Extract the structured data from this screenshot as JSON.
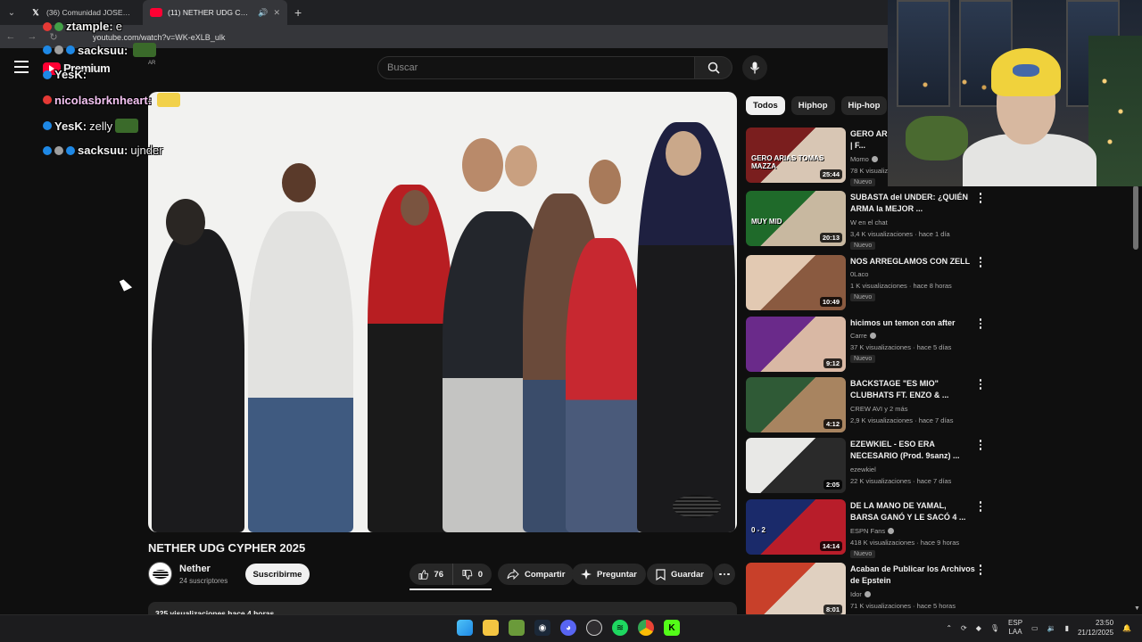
{
  "browser": {
    "tabs": [
      {
        "label": "(36) Comunidad JOSEO EXCLUSIVO",
        "active": false,
        "icon": "x-logo-icon"
      },
      {
        "label": "(11) NETHER UDG CYPHER 2025",
        "active": true,
        "icon": "youtube-icon"
      }
    ],
    "new_tab": "+",
    "url": "youtube.com/watch?v=WK-eXLB_ulk"
  },
  "youtube": {
    "logo_text": "Premium",
    "country_code": "AR",
    "search_placeholder": "Buscar",
    "video": {
      "title": "NETHER UDG CYPHER 2025",
      "channel": "Nether",
      "subscribers": "24 suscriptores",
      "subscribe_label": "Suscribirme",
      "likes": "76",
      "dislikes": "0",
      "share_label": "Compartir",
      "ask_label": "Preguntar",
      "save_label": "Guardar",
      "description_stats": "325 visualizaciones  hace 4 horas"
    },
    "chips": [
      "Todos",
      "Hiphop",
      "Hip-hop"
    ],
    "recommendations": [
      {
        "title": "GERO ARIAS VS TOMAS MAZZA | F...",
        "channel": "Momo",
        "verified": true,
        "meta": "78 K visualizaciones",
        "badge": "Nuevo",
        "duration": "25:44",
        "thumb_overlay": "GERO ARIAS TOMAS MAZZA",
        "colors": [
          "#7a1e1e",
          "#d8c6b4"
        ]
      },
      {
        "title": "SUBASTA del UNDER: ¿QUIÉN ARMA la MEJOR ...",
        "channel": "W en el chat",
        "verified": false,
        "meta": "3,4 K visualizaciones · hace 1 día",
        "badge": "Nuevo",
        "duration": "20:13",
        "thumb_overlay": "MUY MID",
        "colors": [
          "#1f6a2a",
          "#c8b8a0"
        ]
      },
      {
        "title": "NOS ARREGLAMOS CON ZELL",
        "channel": "0Laco",
        "verified": false,
        "meta": "1 K visualizaciones · hace 8 horas",
        "badge": "Nuevo",
        "duration": "10:49",
        "thumb_overlay": "",
        "colors": [
          "#e2c9b2",
          "#8a5a40"
        ]
      },
      {
        "title": "hicimos un temon con after",
        "channel": "Carre",
        "verified": true,
        "meta": "37 K visualizaciones · hace 5 días",
        "badge": "Nuevo",
        "duration": "9:12",
        "thumb_overlay": "",
        "colors": [
          "#6a2a8a",
          "#d9b8a4"
        ]
      },
      {
        "title": "BACKSTAGE \"ES MIO\" CLUBHATS FT. ENZO & ...",
        "channel": "CREW AVI y 2 más",
        "verified": false,
        "meta": "2,9 K visualizaciones · hace 7 días",
        "badge": "",
        "duration": "4:12",
        "thumb_overlay": "",
        "colors": [
          "#2f5a36",
          "#a88460"
        ]
      },
      {
        "title": "EZEWKIEL - ESO ERA NECESARIO (Prod. 9sanz) ...",
        "channel": "ezewkiel",
        "verified": false,
        "meta": "22 K visualizaciones · hace 7 días",
        "badge": "",
        "duration": "2:05",
        "thumb_overlay": "",
        "colors": [
          "#e8e8e6",
          "#2a2a2a"
        ]
      },
      {
        "title": "DE LA MANO DE YAMAL, BARSA GANÓ Y LE SACÓ 4 ...",
        "channel": "ESPN Fans",
        "verified": true,
        "meta": "418 K visualizaciones · hace 9 horas",
        "badge": "Nuevo",
        "duration": "14:14",
        "thumb_overlay": "0 - 2",
        "colors": [
          "#1a2a6a",
          "#b81d2a"
        ]
      },
      {
        "title": "Acaban de Publicar los Archivos de Epstein",
        "channel": "Idor",
        "verified": true,
        "meta": "71 K visualizaciones · hace 5 horas",
        "badge": "",
        "duration": "8:01",
        "thumb_overlay": "",
        "colors": [
          "#c8402a",
          "#e0d0c0"
        ]
      }
    ]
  },
  "chat_overlay": [
    {
      "user": "ztample:",
      "message": " e",
      "badge_colors": [
        "#e53935",
        "#43a047"
      ],
      "name_color": "#f2f2f2"
    },
    {
      "user": "sacksuu:",
      "message": "",
      "badge_colors": [
        "#1e88e5",
        "#9e9e9e",
        "#1e88e5"
      ],
      "name_color": "#f2f2f2"
    },
    {
      "user": "YesK:",
      "message": "",
      "badge_colors": [
        "#1e88e5"
      ],
      "name_color": "#f2f2f2"
    },
    {
      "user": "nicolasbrknheart:",
      "message": "",
      "badge_colors": [
        "#e53935"
      ],
      "name_color": "#f2c2f0"
    },
    {
      "user": "YesK:",
      "message": " zelly",
      "badge_colors": [
        "#1e88e5"
      ],
      "name_color": "#f2f2f2"
    },
    {
      "user": "sacksuu:",
      "message": " ujnder",
      "badge_colors": [
        "#1e88e5",
        "#9e9e9e",
        "#1e88e5"
      ],
      "name_color": "#f2f2f2"
    }
  ],
  "taskbar": {
    "apps": [
      "windows-start",
      "file-explorer",
      "minecraft",
      "steam",
      "discord",
      "obs",
      "spotify",
      "chrome",
      "kick"
    ],
    "language": "ESP",
    "language_sub": "LAA",
    "time": "23:50",
    "date": "21/12/2025"
  }
}
